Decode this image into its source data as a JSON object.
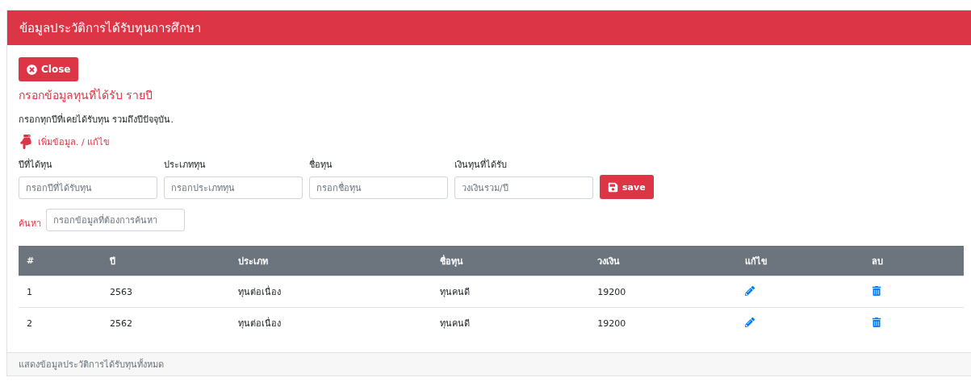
{
  "card": {
    "title": "ข้อมูลประวัติการได้รับทุนการศึกษา"
  },
  "close_button": "Close",
  "section_title": "กรอกข้อมูลทุนที่ได้รับ รายปี",
  "instruction": "กรอกทุกปีที่เคยได้รับทุน รวมถึงปีปัจจุบัน.",
  "edit_link": "เพิ่มข้อมูล. / แก้ไข",
  "form": {
    "fields": [
      {
        "label": "ปีที่ได้ทุน",
        "placeholder": "กรอกปีที่ได้รับทุน"
      },
      {
        "label": "ประเภททุน",
        "placeholder": "กรอกประเภททุน"
      },
      {
        "label": "ชื่อทุน",
        "placeholder": "กรอกชื่อทุน"
      },
      {
        "label": "เงินทุนที่ได้รับ",
        "placeholder": "วงเงินรวม/ปี"
      }
    ],
    "save_button": "save"
  },
  "search": {
    "label": "ค้นหา",
    "placeholder": "กรอกข้อมูลที่ต้องการค้นหา"
  },
  "table": {
    "columns": [
      "#",
      "ปี",
      "ประเภท",
      "ชื่อทุน",
      "วงเงิน",
      "แก้ไข",
      "ลบ"
    ],
    "rows": [
      {
        "cells": [
          "1",
          "2563",
          "ทุนต่อเนื่อง",
          "ทุนคนดี",
          "19200"
        ]
      },
      {
        "cells": [
          "2",
          "2562",
          "ทุนต่อเนื่อง",
          "ทุนคนดี",
          "19200"
        ]
      }
    ]
  },
  "footer": "แสดงข้อมูลประวัติการได้รับทุนทั้งหมด"
}
